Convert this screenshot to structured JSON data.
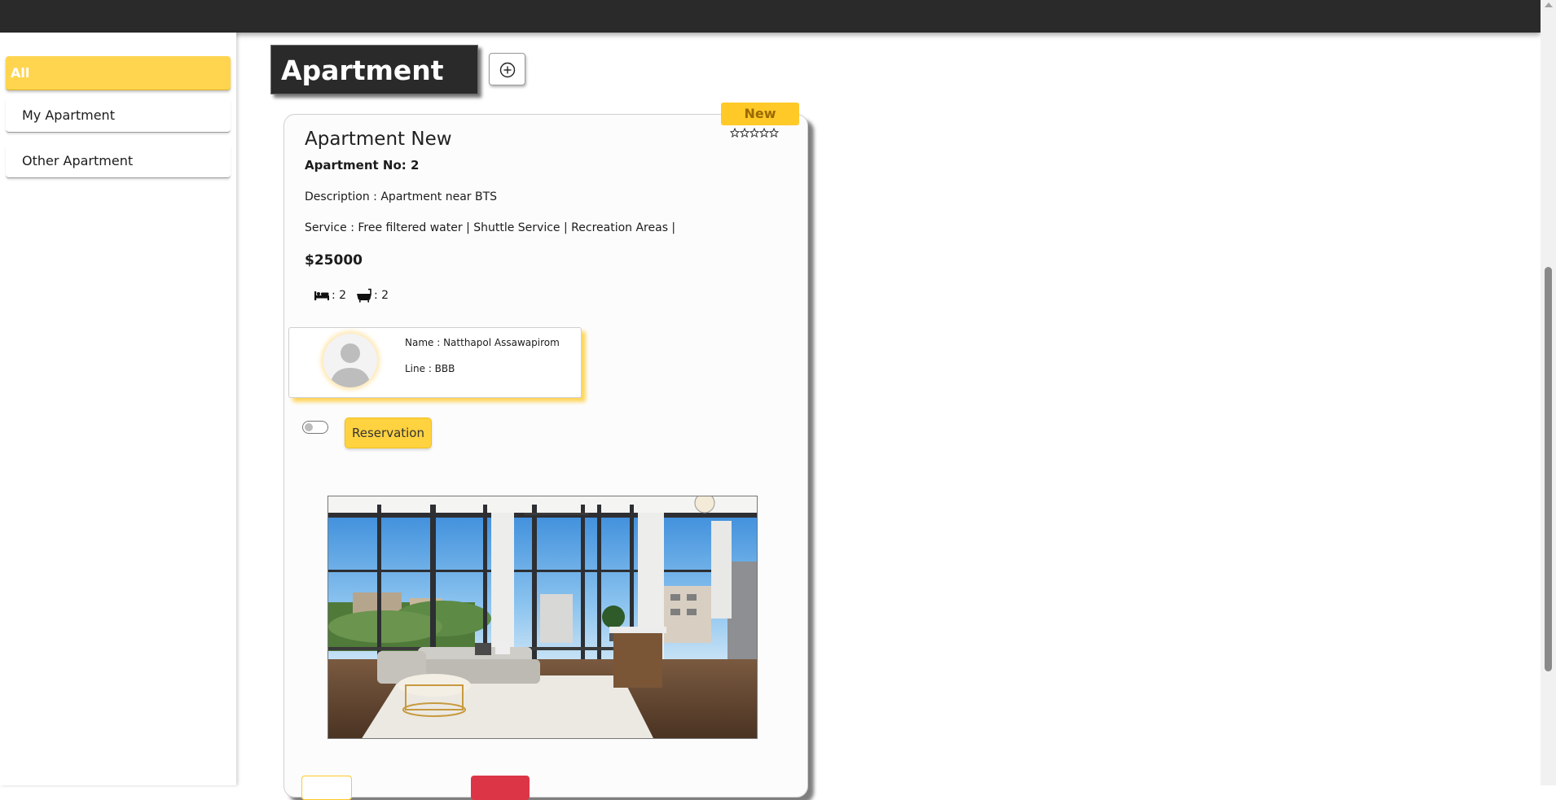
{
  "sidebar": {
    "items": [
      {
        "label": "All"
      },
      {
        "label": "My Apartment"
      },
      {
        "label": "Other Apartment"
      }
    ]
  },
  "header": {
    "title": "Apartment",
    "add_icon": "plus-circle-icon"
  },
  "card": {
    "badge": "New",
    "rating_stars": 0,
    "rating_max": 5,
    "title": "Apartment New",
    "apartment_no": "Apartment No: 2",
    "description": "Description : Apartment near BTS",
    "service": "Service : Free filtered water | Shuttle Service | Recreation Areas |",
    "price": "$25000",
    "bed_count": ": 2",
    "bath_count": ": 2",
    "owner": {
      "name": "Name : Natthapol Assawapirom",
      "line": "Line : BBB"
    },
    "reservation_label": "Reservation",
    "toggle_on": false
  },
  "colors": {
    "accent": "#ffd54f",
    "badge": "#ffc928",
    "dark": "#2a2a2a",
    "danger": "#dc3545"
  }
}
